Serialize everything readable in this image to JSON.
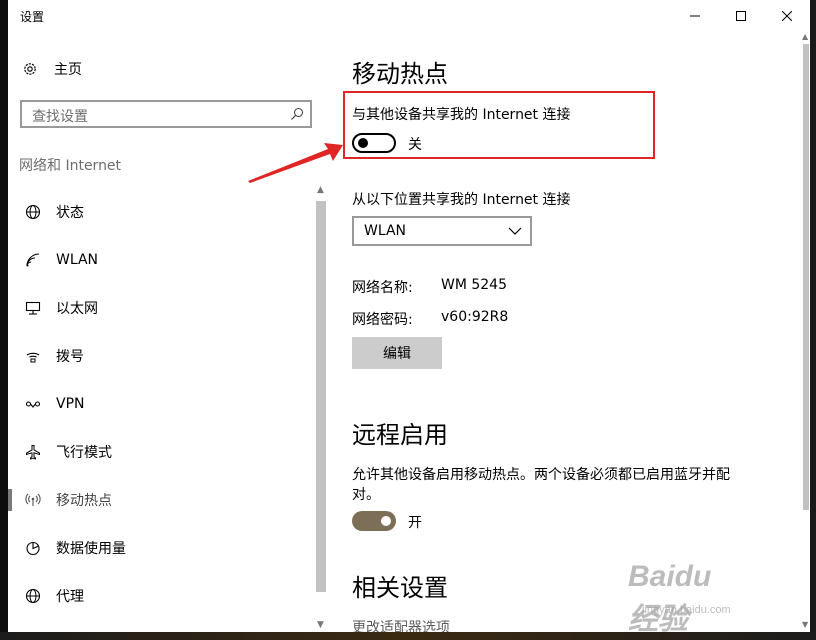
{
  "window": {
    "title": "设置"
  },
  "sidebar": {
    "home_label": "主页",
    "search_placeholder": "查找设置",
    "section_title": "网络和 Internet",
    "items": [
      {
        "label": "状态",
        "icon": "globe-icon"
      },
      {
        "label": "WLAN",
        "icon": "wifi-icon"
      },
      {
        "label": "以太网",
        "icon": "ethernet-icon"
      },
      {
        "label": "拨号",
        "icon": "dialup-icon"
      },
      {
        "label": "VPN",
        "icon": "vpn-icon"
      },
      {
        "label": "飞行模式",
        "icon": "airplane-icon"
      },
      {
        "label": "移动热点",
        "icon": "hotspot-icon",
        "selected": true
      },
      {
        "label": "数据使用量",
        "icon": "data-usage-icon"
      },
      {
        "label": "代理",
        "icon": "proxy-globe-icon"
      }
    ]
  },
  "main": {
    "title": "移动热点",
    "share_label": "与其他设备共享我的 Internet 连接",
    "share_toggle_state": "关",
    "share_from_label": "从以下位置共享我的 Internet 连接",
    "share_from_selected": "WLAN",
    "network_name_key": "网络名称:",
    "network_name_value": "WM 5245",
    "network_password_key": "网络密码:",
    "network_password_value": "v60:92R8",
    "edit_button": "编辑",
    "remote_title": "远程启用",
    "remote_desc_line1": "允许其他设备启用移动热点。两个设备必须都已启用蓝牙并配",
    "remote_desc_line2": "对。",
    "remote_toggle_state": "开",
    "related_title": "相关设置",
    "related_link": "更改适配器选项"
  },
  "watermark": {
    "logo": "Baidu经验",
    "url": "jingyan.baidu.com"
  },
  "colors": {
    "highlight_box": "#e02525",
    "toggle_on": "#7d6e57",
    "accent_arrow": "#e02525"
  }
}
